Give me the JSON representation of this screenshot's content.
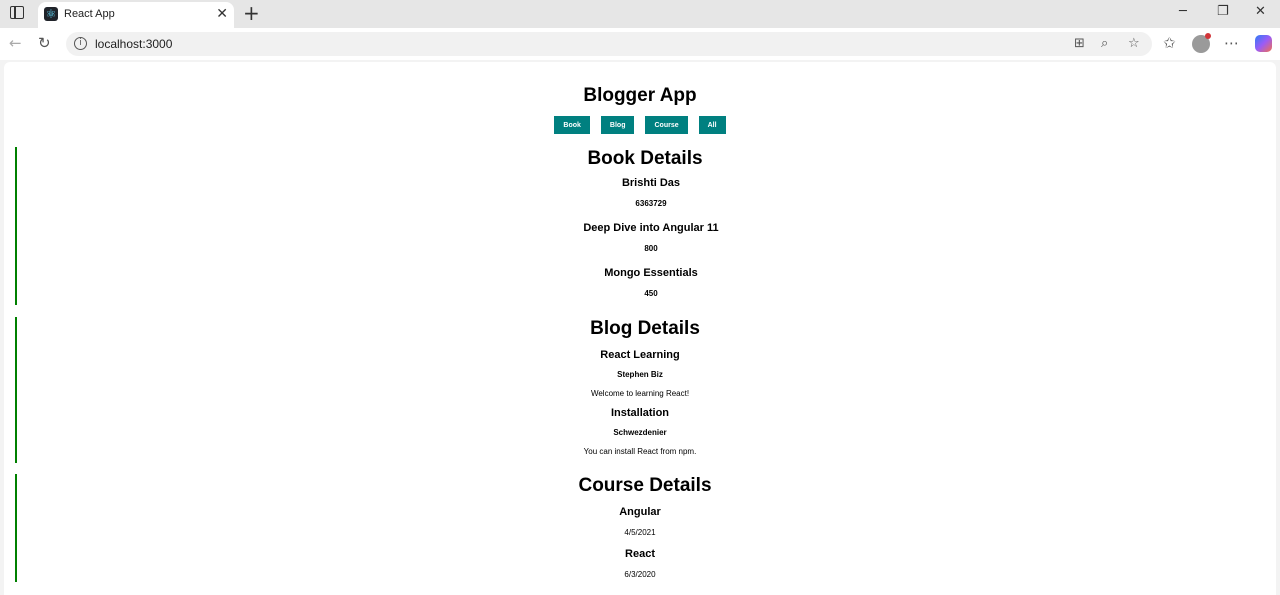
{
  "browser": {
    "tab_title": "React App",
    "tab_favicon": "react-logo-icon",
    "url": "localhost:3000",
    "window_buttons": [
      "minimize-icon",
      "restore-icon",
      "close-icon"
    ]
  },
  "app": {
    "title": "Blogger App",
    "nav": [
      "Book",
      "Blog",
      "Course",
      "All"
    ],
    "accent_color": "#008080",
    "rule_color": "#008000"
  },
  "books": {
    "heading": "Book Details",
    "items": [
      {
        "title": "Brishti Das",
        "value": "6363729"
      },
      {
        "title": "Deep Dive into Angular 11",
        "value": "800"
      },
      {
        "title": "Mongo Essentials",
        "value": "450"
      }
    ]
  },
  "blogs": {
    "heading": "Blog Details",
    "items": [
      {
        "title": "React Learning",
        "author": "Stephen Biz",
        "text": "Welcome to learning React!"
      },
      {
        "title": "Installation",
        "author": "Schwezdenier",
        "text": "You can install React from npm."
      }
    ]
  },
  "courses": {
    "heading": "Course Details",
    "items": [
      {
        "title": "Angular",
        "date": "4/5/2021"
      },
      {
        "title": "React",
        "date": "6/3/2020"
      }
    ]
  }
}
